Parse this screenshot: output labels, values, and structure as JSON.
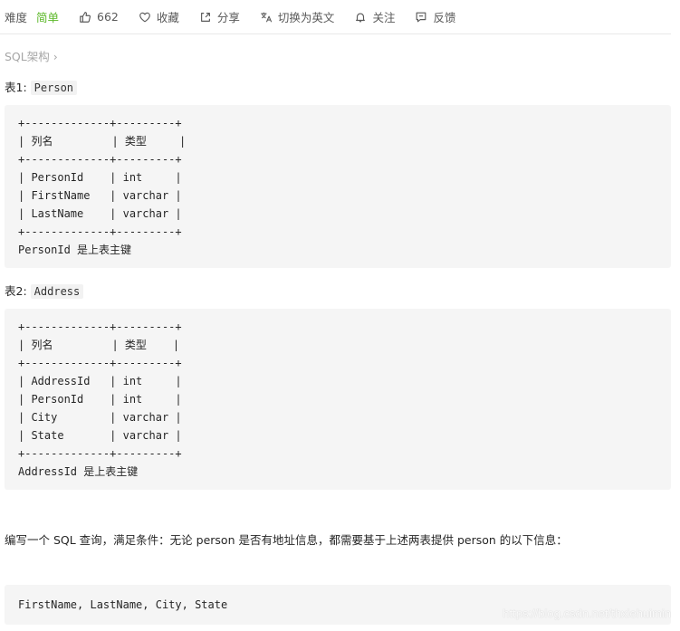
{
  "toolbar": {
    "difficulty_label": "难度",
    "difficulty_value": "简单",
    "likes": "662",
    "favorite": "收藏",
    "share": "分享",
    "translate": "切换为英文",
    "follow": "关注",
    "feedback": "反馈",
    "difficulty_color": "#5ab726"
  },
  "breadcrumb": {
    "label": "SQL架构",
    "chevron": "›"
  },
  "table1": {
    "label": "表1:",
    "name": "Person",
    "code": "+-------------+---------+\n| 列名         | 类型     |\n+-------------+---------+\n| PersonId    | int     |\n| FirstName   | varchar |\n| LastName    | varchar |\n+-------------+---------+\nPersonId 是上表主键"
  },
  "table2": {
    "label": "表2:",
    "name": "Address",
    "code": "+-------------+---------+\n| 列名         | 类型    |\n+-------------+---------+\n| AddressId   | int     |\n| PersonId    | int     |\n| City        | varchar |\n| State       | varchar |\n+-------------+---------+\nAddressId 是上表主键"
  },
  "description": "编写一个 SQL 查询，满足条件：无论 person 是否有地址信息，都需要基于上述两表提供 person 的以下信息：",
  "result_columns": "FirstName, LastName, City, State",
  "watermark": "https://blog.csdn.net/thxiehuimin"
}
